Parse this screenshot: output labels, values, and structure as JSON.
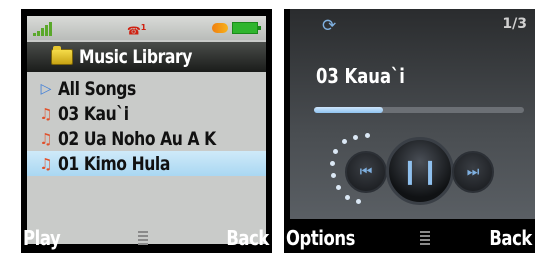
{
  "library": {
    "title": "Music Library",
    "status": {
      "call_indicator": "1"
    },
    "items": [
      {
        "label": "All Songs",
        "icon": "play-triangle-icon",
        "selected": false
      },
      {
        "label": "03 Kau`i",
        "icon": "music-note-icon",
        "selected": false
      },
      {
        "label": "02 Ua Noho Au A K",
        "icon": "music-note-icon",
        "selected": false
      },
      {
        "label": "01 Kimo Hula",
        "icon": "music-note-icon",
        "selected": true
      }
    ],
    "softkeys": {
      "left": "Play",
      "right": "Back"
    }
  },
  "player": {
    "track_counter": "1/3",
    "song_title": "03 Kaua`i",
    "progress": 0.33,
    "softkeys": {
      "left": "Options",
      "right": "Back"
    }
  },
  "colors": {
    "selection": "#a9d7f2",
    "accent_blue": "#7fb0e0",
    "note_orange": "#e0502a",
    "battery_green": "#2fb52e"
  }
}
